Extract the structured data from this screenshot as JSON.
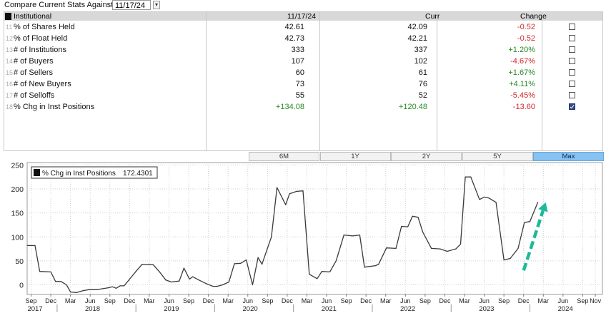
{
  "toolbar": {
    "compare_label": "Compare Current Stats Against",
    "compare_date": "11/17/24",
    "dropdown_icon": "chevron-down-icon"
  },
  "table": {
    "headers": {
      "name": "Institutional",
      "date": "11/17/24",
      "curr": "Curr",
      "change": "Change"
    },
    "rows": [
      {
        "num": "11",
        "label": "% of Shares Held",
        "date_val": "42.61",
        "curr_val": "42.09",
        "change": "-0.52",
        "date_color": "neu",
        "curr_color": "neu",
        "change_color": "neg",
        "checked": false
      },
      {
        "num": "12",
        "label": "% of Float Held",
        "date_val": "42.73",
        "curr_val": "42.21",
        "change": "-0.52",
        "date_color": "neu",
        "curr_color": "neu",
        "change_color": "neg",
        "checked": false
      },
      {
        "num": "13",
        "label": "# of Institutions",
        "date_val": "333",
        "curr_val": "337",
        "change": "+1.20%",
        "date_color": "neu",
        "curr_color": "neu",
        "change_color": "pos",
        "checked": false
      },
      {
        "num": "14",
        "label": "# of Buyers",
        "date_val": "107",
        "curr_val": "102",
        "change": "-4.67%",
        "date_color": "neu",
        "curr_color": "neu",
        "change_color": "neg",
        "checked": false
      },
      {
        "num": "15",
        "label": "# of Sellers",
        "date_val": "60",
        "curr_val": "61",
        "change": "+1.67%",
        "date_color": "neu",
        "curr_color": "neu",
        "change_color": "pos",
        "checked": false
      },
      {
        "num": "16",
        "label": "# of New Buyers",
        "date_val": "73",
        "curr_val": "76",
        "change": "+4.11%",
        "date_color": "neu",
        "curr_color": "neu",
        "change_color": "pos",
        "checked": false
      },
      {
        "num": "17",
        "label": "# of Selloffs",
        "date_val": "55",
        "curr_val": "52",
        "change": "-5.45%",
        "date_color": "neu",
        "curr_color": "neu",
        "change_color": "neg",
        "checked": false
      },
      {
        "num": "18",
        "label": "% Chg in Inst Positions",
        "date_val": "+134.08",
        "curr_val": "+120.48",
        "change": "-13.60",
        "date_color": "pos",
        "curr_color": "pos",
        "change_color": "neg",
        "checked": true
      }
    ]
  },
  "range_buttons": [
    {
      "label": "6M",
      "active": false
    },
    {
      "label": "1Y",
      "active": false
    },
    {
      "label": "2Y",
      "active": false
    },
    {
      "label": "5Y",
      "active": false
    },
    {
      "label": "Max",
      "active": true
    }
  ],
  "chart_data": {
    "type": "line",
    "legend": {
      "label": "% Chg in Inst Positions",
      "value": "172.4301"
    },
    "ylim": [
      -20,
      255
    ],
    "yticks": [
      0,
      50,
      100,
      150,
      200,
      250
    ],
    "xlim": [
      2017.62,
      2024.92
    ],
    "x_month_ticks": [
      {
        "x": 2017.67,
        "label": "Sep"
      },
      {
        "x": 2017.92,
        "label": "Dec"
      },
      {
        "x": 2018.17,
        "label": "Mar"
      },
      {
        "x": 2018.42,
        "label": "Jun"
      },
      {
        "x": 2018.67,
        "label": "Sep"
      },
      {
        "x": 2018.92,
        "label": "Dec"
      },
      {
        "x": 2019.17,
        "label": "Mar"
      },
      {
        "x": 2019.42,
        "label": "Jun"
      },
      {
        "x": 2019.67,
        "label": "Sep"
      },
      {
        "x": 2019.92,
        "label": "Dec"
      },
      {
        "x": 2020.17,
        "label": "Mar"
      },
      {
        "x": 2020.42,
        "label": "Jun"
      },
      {
        "x": 2020.67,
        "label": "Sep"
      },
      {
        "x": 2020.92,
        "label": "Dec"
      },
      {
        "x": 2021.17,
        "label": "Mar"
      },
      {
        "x": 2021.42,
        "label": "Jun"
      },
      {
        "x": 2021.67,
        "label": "Sep"
      },
      {
        "x": 2021.92,
        "label": "Dec"
      },
      {
        "x": 2022.17,
        "label": "Mar"
      },
      {
        "x": 2022.42,
        "label": "Jun"
      },
      {
        "x": 2022.67,
        "label": "Sep"
      },
      {
        "x": 2022.92,
        "label": "Dec"
      },
      {
        "x": 2023.17,
        "label": "Mar"
      },
      {
        "x": 2023.42,
        "label": "Jun"
      },
      {
        "x": 2023.67,
        "label": "Sep"
      },
      {
        "x": 2023.92,
        "label": "Dec"
      },
      {
        "x": 2024.17,
        "label": "Mar"
      },
      {
        "x": 2024.42,
        "label": "Jun"
      },
      {
        "x": 2024.67,
        "label": "Sep"
      },
      {
        "x": 2024.83,
        "label": "Nov"
      }
    ],
    "x_year_labels": [
      {
        "x": 2017.72,
        "label": "2017"
      },
      {
        "x": 2018.45,
        "label": "2018"
      },
      {
        "x": 2019.45,
        "label": "2019"
      },
      {
        "x": 2020.45,
        "label": "2020"
      },
      {
        "x": 2021.45,
        "label": "2021"
      },
      {
        "x": 2022.45,
        "label": "2022"
      },
      {
        "x": 2023.45,
        "label": "2023"
      },
      {
        "x": 2024.45,
        "label": "2024"
      }
    ],
    "series": [
      {
        "name": "% Chg in Inst Positions",
        "color": "#3a3a3a",
        "points": [
          [
            2017.62,
            82
          ],
          [
            2017.72,
            82
          ],
          [
            2017.78,
            28
          ],
          [
            2017.92,
            27
          ],
          [
            2017.98,
            7
          ],
          [
            2018.05,
            7
          ],
          [
            2018.12,
            0
          ],
          [
            2018.17,
            -15
          ],
          [
            2018.25,
            -16
          ],
          [
            2018.33,
            -12
          ],
          [
            2018.4,
            -10
          ],
          [
            2018.5,
            -10
          ],
          [
            2018.58,
            -8
          ],
          [
            2018.65,
            -6
          ],
          [
            2018.7,
            -4
          ],
          [
            2018.75,
            -7
          ],
          [
            2018.8,
            -2
          ],
          [
            2018.85,
            -2
          ],
          [
            2018.92,
            12
          ],
          [
            2019.0,
            28
          ],
          [
            2019.08,
            43
          ],
          [
            2019.22,
            42
          ],
          [
            2019.3,
            27
          ],
          [
            2019.38,
            10
          ],
          [
            2019.45,
            6
          ],
          [
            2019.55,
            8
          ],
          [
            2019.61,
            35
          ],
          [
            2019.68,
            12
          ],
          [
            2019.72,
            17
          ],
          [
            2019.8,
            10
          ],
          [
            2019.9,
            2
          ],
          [
            2019.98,
            -3
          ],
          [
            2020.03,
            -3
          ],
          [
            2020.1,
            0
          ],
          [
            2020.18,
            6
          ],
          [
            2020.25,
            44
          ],
          [
            2020.33,
            45
          ],
          [
            2020.4,
            52
          ],
          [
            2020.48,
            0
          ],
          [
            2020.55,
            57
          ],
          [
            2020.6,
            43
          ],
          [
            2020.72,
            100
          ],
          [
            2020.79,
            203
          ],
          [
            2020.9,
            167
          ],
          [
            2020.95,
            190
          ],
          [
            2021.04,
            195
          ],
          [
            2021.12,
            196
          ],
          [
            2021.2,
            22
          ],
          [
            2021.3,
            13
          ],
          [
            2021.36,
            28
          ],
          [
            2021.46,
            27
          ],
          [
            2021.54,
            50
          ],
          [
            2021.64,
            104
          ],
          [
            2021.75,
            102
          ],
          [
            2021.84,
            104
          ],
          [
            2021.9,
            37
          ],
          [
            2022.04,
            40
          ],
          [
            2022.08,
            43
          ],
          [
            2022.18,
            77
          ],
          [
            2022.3,
            76
          ],
          [
            2022.37,
            122
          ],
          [
            2022.45,
            121
          ],
          [
            2022.51,
            143
          ],
          [
            2022.58,
            141
          ],
          [
            2022.64,
            110
          ],
          [
            2022.75,
            76
          ],
          [
            2022.86,
            75
          ],
          [
            2022.95,
            70
          ],
          [
            2023.06,
            75
          ],
          [
            2023.12,
            85
          ],
          [
            2023.18,
            225
          ],
          [
            2023.25,
            225
          ],
          [
            2023.36,
            178
          ],
          [
            2023.42,
            183
          ],
          [
            2023.48,
            181
          ],
          [
            2023.57,
            172
          ],
          [
            2023.67,
            52
          ],
          [
            2023.75,
            55
          ],
          [
            2023.85,
            76
          ],
          [
            2023.93,
            130
          ],
          [
            2024.0,
            132
          ],
          [
            2024.1,
            172
          ]
        ]
      }
    ],
    "annotation_arrow": {
      "color": "#1db99a",
      "from": [
        2023.92,
        30
      ],
      "to": [
        2024.2,
        172
      ]
    }
  }
}
